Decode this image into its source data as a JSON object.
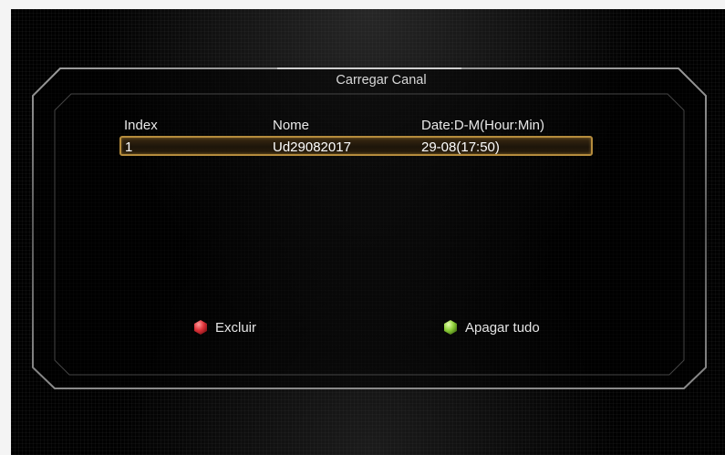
{
  "dialog": {
    "title": "Carregar Canal"
  },
  "table": {
    "columns": [
      "Index",
      "Nome",
      "Date:D-M(Hour:Min)"
    ],
    "rows": [
      {
        "index": "1",
        "name": "Ud29082017",
        "date": "29-08(17:50)"
      }
    ]
  },
  "legend": {
    "delete": {
      "label": "Excluir",
      "color": "#e0333a",
      "icon": "red-key-icon"
    },
    "clear_all": {
      "label": "Apagar tudo",
      "color": "#8fd13a",
      "icon": "green-key-icon"
    }
  },
  "colors": {
    "highlight_border": "#b58c3d"
  }
}
